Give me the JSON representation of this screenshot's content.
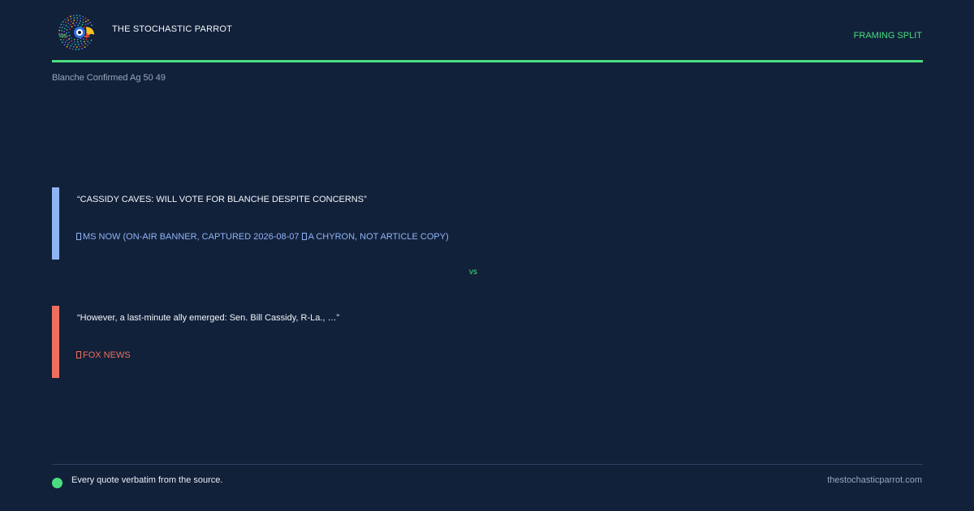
{
  "header": {
    "logo_icon": "parrot-logo-icon",
    "brand_name": "THE STOCHASTIC PARROT",
    "mode_label": "FRAMING SPLIT",
    "accent_color": "#4ade80"
  },
  "slug": "Blanche Confirmed Ag 50 49",
  "quotes": [
    {
      "text": "“CASSIDY CAVES: WILL VOTE FOR BLANCHE DESPITE CONCERNS”",
      "source": "MS NOW (ON-AIR BANNER, CAPTURED 2026-08-07",
      "source_note": "A CHYRON, NOT ARTICLE COPY)",
      "color": "#8fb4f4",
      "source_icon": "source-glyph-icon"
    },
    {
      "text": "“However, a last-minute ally emerged: Sen. Bill Cassidy, R-La., …”",
      "source": "FOX NEWS",
      "color": "#ef6f5e",
      "source_icon": "source-glyph-icon"
    }
  ],
  "divider_label": "vs",
  "footer": {
    "note": "Every quote verbatim from the source.",
    "site": "thestochasticparrot.com"
  }
}
